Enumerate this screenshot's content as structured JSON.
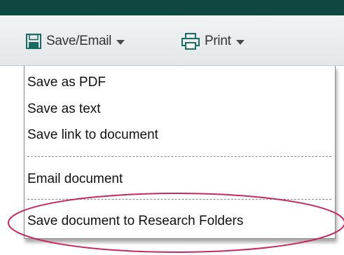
{
  "toolbar": {
    "save_email": {
      "label": "Save/Email",
      "icon": "floppy-disk-icon"
    },
    "print": {
      "label": "Print",
      "icon": "printer-icon"
    }
  },
  "menu": {
    "items": [
      {
        "label": "Save as PDF"
      },
      {
        "label": "Save as text"
      },
      {
        "label": "Save link to document"
      },
      {
        "label": "Email document"
      },
      {
        "label": "Save document to Research Folders"
      }
    ]
  },
  "colors": {
    "top_bar": "#0f4840",
    "icon": "#1b6b62",
    "highlight_ring": "#c8285e"
  }
}
